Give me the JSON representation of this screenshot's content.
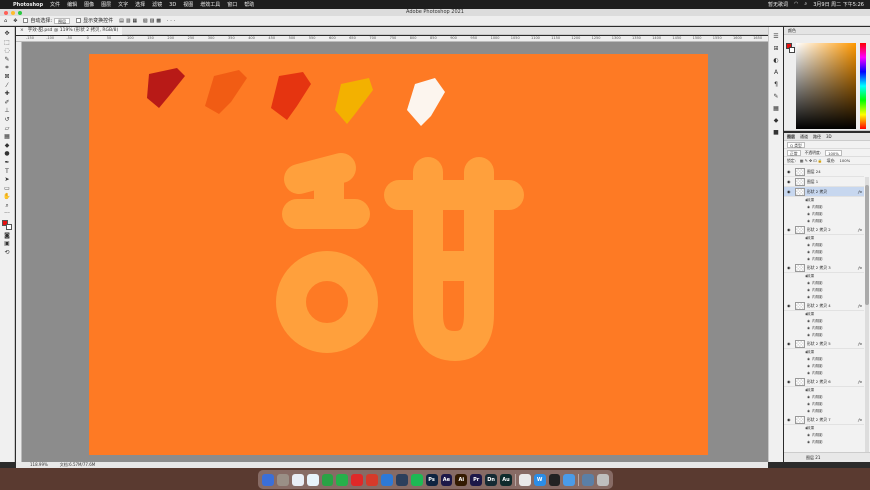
{
  "menubar": {
    "app": "Photoshop",
    "items": [
      "文件",
      "编辑",
      "图像",
      "图层",
      "文字",
      "选择",
      "滤镜",
      "3D",
      "视图",
      "增效工具",
      "窗口",
      "帮助"
    ],
    "ime": "暂无歌词",
    "clock": "3月9日 周二 下午5:26"
  },
  "titlebar": {
    "title": "Adobe Photoshop 2021"
  },
  "options": {
    "auto_select_label": "自动选择:",
    "auto_select_value": "图层",
    "transform_label": "显示变换控件"
  },
  "document": {
    "tab_title": "字效-甜.psd @ 119% (形状 2 拷贝, RGB/8)",
    "close": "×"
  },
  "ruler": {
    "ticks": [
      "-150",
      "-100",
      "-50",
      "0",
      "50",
      "100",
      "150",
      "200",
      "250",
      "300",
      "350",
      "400",
      "450",
      "500",
      "550",
      "600",
      "650",
      "700",
      "750",
      "800",
      "850",
      "900",
      "950",
      "1000",
      "1050",
      "1100",
      "1150",
      "1200",
      "1250",
      "1300",
      "1350",
      "1400",
      "1450",
      "1500",
      "1550",
      "1600",
      "1650"
    ]
  },
  "canvas": {
    "background_color": "#fe7a24",
    "glyph_color": "#ffa03c",
    "swatches": [
      "#b81a17",
      "#f15c14",
      "#e53410",
      "#f3b100",
      "#fcf5ee"
    ]
  },
  "status": {
    "zoom": "118.99%",
    "docsize": "文档:6.57M/77.6M"
  },
  "color_panel": {
    "title": "颜色",
    "foreground": "#e50f0f",
    "background": "#ffffff"
  },
  "layers_panel": {
    "tabs": [
      "图层",
      "通道",
      "路径",
      "3D"
    ],
    "filter": "Q 类型",
    "blend_mode": "正常",
    "opacity_label": "不透明度:",
    "opacity_value": "100%",
    "lock_label": "锁定:",
    "fill_label": "填充:",
    "fill_value": "100%",
    "layers": [
      {
        "name": "图层 24",
        "selected": false,
        "fx": false,
        "effects_label": "",
        "subs": []
      },
      {
        "name": "图层 1",
        "selected": false,
        "fx": false,
        "effects_label": "",
        "subs": []
      },
      {
        "name": "形状 2 拷贝",
        "selected": true,
        "fx": true,
        "effects_label": "效果",
        "subs": [
          "内阴影",
          "内阴影",
          "内阴影"
        ]
      },
      {
        "name": "形状 2 拷贝 2",
        "selected": false,
        "fx": true,
        "effects_label": "效果",
        "subs": [
          "内阴影",
          "内阴影",
          "内阴影"
        ]
      },
      {
        "name": "形状 2 拷贝 3",
        "selected": false,
        "fx": true,
        "effects_label": "效果",
        "subs": [
          "内阴影",
          "内阴影",
          "内阴影"
        ]
      },
      {
        "name": "形状 2 拷贝 4",
        "selected": false,
        "fx": true,
        "effects_label": "效果",
        "subs": [
          "内阴影",
          "内阴影",
          "内阴影"
        ]
      },
      {
        "name": "形状 2 拷贝 5",
        "selected": false,
        "fx": true,
        "effects_label": "效果",
        "subs": [
          "内阴影",
          "内阴影",
          "内阴影"
        ]
      },
      {
        "name": "形状 2 拷贝 6",
        "selected": false,
        "fx": true,
        "effects_label": "效果",
        "subs": [
          "内阴影",
          "内阴影",
          "内阴影"
        ]
      },
      {
        "name": "形状 2 拷贝 7",
        "selected": false,
        "fx": true,
        "effects_label": "效果",
        "subs": [
          "内阴影",
          "内阴影"
        ]
      }
    ],
    "bottom_layer": "图层 21"
  },
  "dock": {
    "apps": [
      {
        "label": "",
        "color": "#3b6fd8"
      },
      {
        "label": "",
        "color": "#9a8f86"
      },
      {
        "label": "",
        "color": "#e9eef6"
      },
      {
        "label": "",
        "color": "#e8f3fb"
      },
      {
        "label": "",
        "color": "#2aa345"
      },
      {
        "label": "",
        "color": "#27b04a"
      },
      {
        "label": "",
        "color": "#e02828"
      },
      {
        "label": "",
        "color": "#d63a2a"
      },
      {
        "label": "",
        "color": "#2e79d6"
      },
      {
        "label": "",
        "color": "#2c3f5c"
      },
      {
        "label": "",
        "color": "#1db954"
      },
      {
        "label": "Ps",
        "color": "#0f2440"
      },
      {
        "label": "Ae",
        "color": "#1c1848"
      },
      {
        "label": "Ai",
        "color": "#331a00"
      },
      {
        "label": "Pr",
        "color": "#1c1848"
      },
      {
        "label": "Dn",
        "color": "#152a33"
      },
      {
        "label": "Au",
        "color": "#0f2b2c"
      },
      {
        "label": "",
        "color": "#e9e9e9"
      },
      {
        "label": "W",
        "color": "#2b8de6"
      },
      {
        "label": "",
        "color": "#222222"
      },
      {
        "label": "",
        "color": "#4a9be8"
      },
      {
        "label": "",
        "color": "#5b7fa6"
      },
      {
        "label": "",
        "color": "#bfbfbf"
      }
    ]
  }
}
